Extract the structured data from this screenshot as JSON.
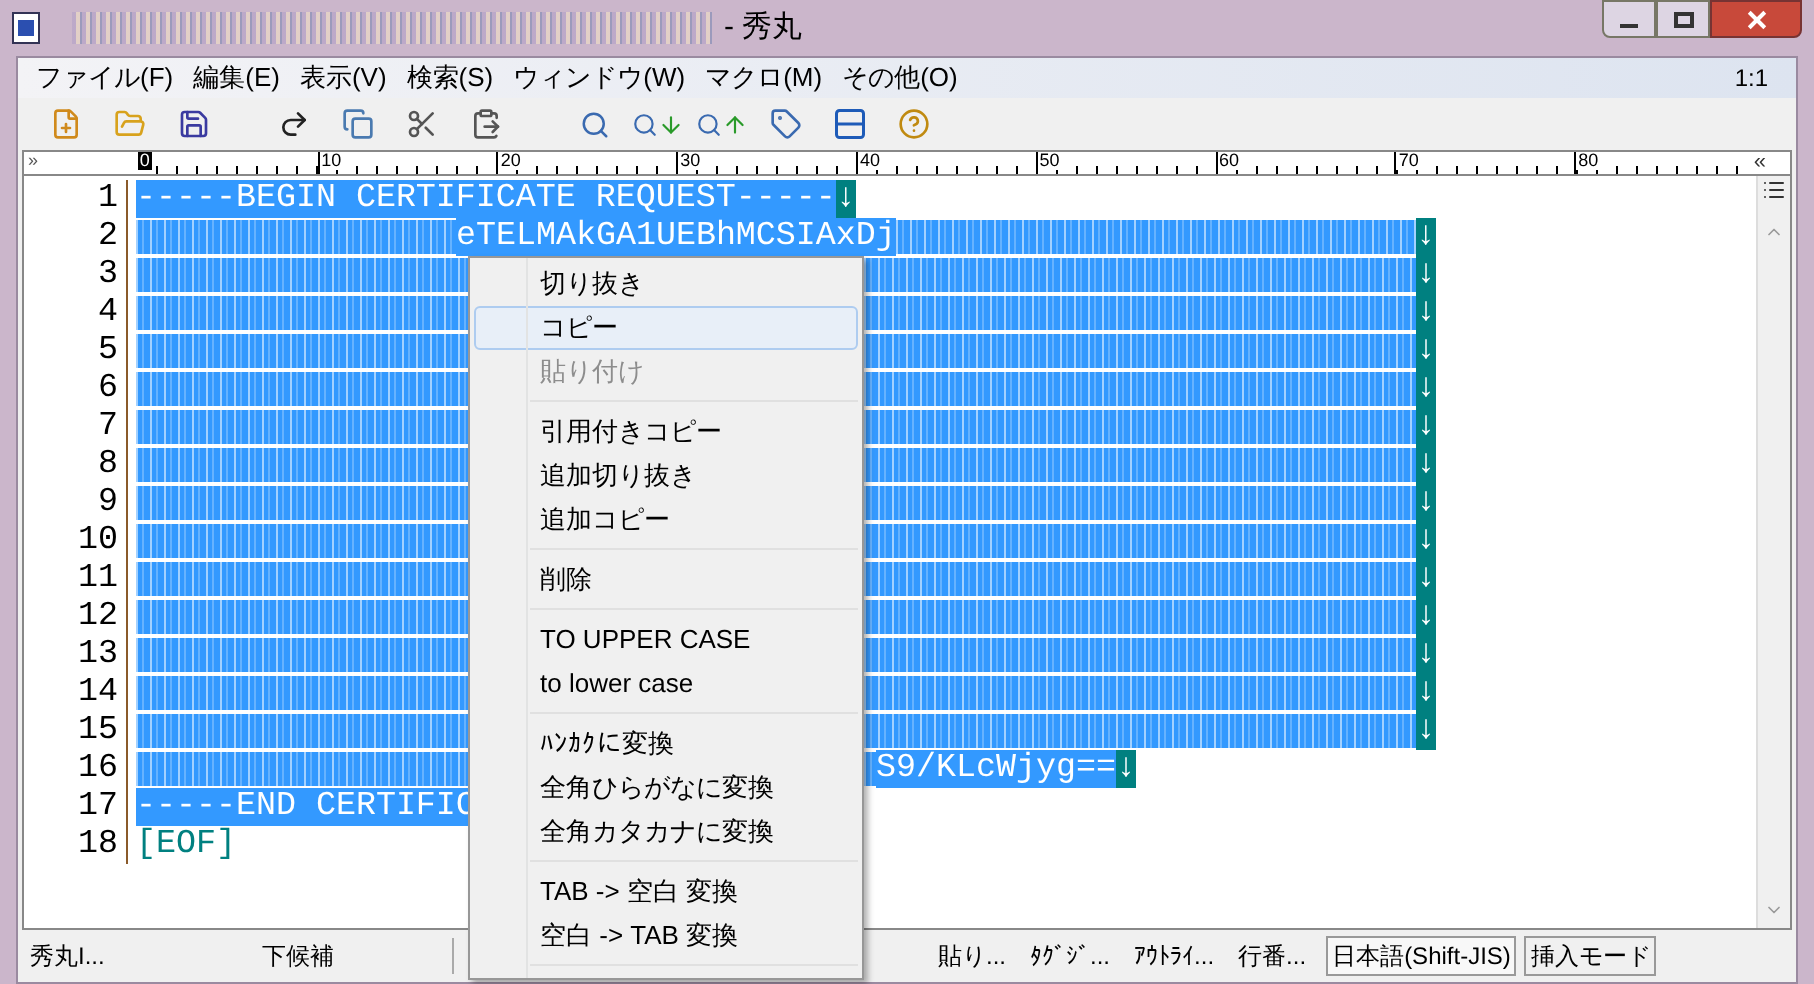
{
  "window": {
    "title": "- 秀丸"
  },
  "menu_bar": {
    "items": [
      {
        "label": "ファイル(F)"
      },
      {
        "label": "編集(E)"
      },
      {
        "label": "表示(V)"
      },
      {
        "label": "検索(S)"
      },
      {
        "label": "ウィンドウ(W)"
      },
      {
        "label": "マクロ(M)"
      },
      {
        "label": "その他(O)"
      }
    ],
    "position": "1:1"
  },
  "ruler": {
    "left_mark": "»",
    "right_mark": "«",
    "start": "0",
    "ticks": [
      "10",
      "20",
      "30",
      "40",
      "50",
      "60",
      "70",
      "80"
    ]
  },
  "editor": {
    "lines": [
      {
        "number": "1",
        "selected": true,
        "segments": [
          {
            "kind": "text",
            "text": "-----BEGIN CERTIFICATE REQUEST-----"
          }
        ],
        "eol": "↓"
      },
      {
        "number": "2",
        "selected": true,
        "segments": [
          {
            "kind": "redacted"
          },
          {
            "kind": "text",
            "text": "eTELMAkGA1UEBhMCSIAxDj"
          },
          {
            "kind": "redacted"
          }
        ],
        "eol": "↓"
      },
      {
        "number": "3",
        "selected": true,
        "segments": [
          {
            "kind": "redacted"
          }
        ],
        "eol": "↓"
      },
      {
        "number": "4",
        "selected": true,
        "segments": [
          {
            "kind": "redacted"
          }
        ],
        "eol": "↓"
      },
      {
        "number": "5",
        "selected": true,
        "segments": [
          {
            "kind": "redacted"
          }
        ],
        "eol": "↓"
      },
      {
        "number": "6",
        "selected": true,
        "segments": [
          {
            "kind": "redacted"
          }
        ],
        "eol": "↓"
      },
      {
        "number": "7",
        "selected": true,
        "segments": [
          {
            "kind": "redacted"
          }
        ],
        "eol": "↓"
      },
      {
        "number": "8",
        "selected": true,
        "segments": [
          {
            "kind": "redacted"
          }
        ],
        "eol": "↓"
      },
      {
        "number": "9",
        "selected": true,
        "segments": [
          {
            "kind": "redacted"
          }
        ],
        "eol": "↓"
      },
      {
        "number": "10",
        "selected": true,
        "segments": [
          {
            "kind": "redacted"
          }
        ],
        "eol": "↓"
      },
      {
        "number": "11",
        "selected": true,
        "segments": [
          {
            "kind": "redacted"
          }
        ],
        "eol": "↓"
      },
      {
        "number": "12",
        "selected": true,
        "segments": [
          {
            "kind": "redacted"
          }
        ],
        "eol": "↓"
      },
      {
        "number": "13",
        "selected": true,
        "segments": [
          {
            "kind": "redacted"
          }
        ],
        "eol": "↓"
      },
      {
        "number": "14",
        "selected": true,
        "segments": [
          {
            "kind": "redacted"
          }
        ],
        "eol": "↓"
      },
      {
        "number": "15",
        "selected": true,
        "segments": [
          {
            "kind": "redacted"
          }
        ],
        "eol": "↓"
      },
      {
        "number": "16",
        "selected": true,
        "segments": [
          {
            "kind": "redacted"
          },
          {
            "kind": "text",
            "text": "S9/KLcWjyg=="
          }
        ],
        "eol": "↓"
      },
      {
        "number": "17",
        "selected": true,
        "segments": [
          {
            "kind": "text",
            "text": "-----END CERTIFIC"
          }
        ]
      },
      {
        "number": "18",
        "selected": false,
        "segments": [
          {
            "kind": "eof",
            "text": "[EOF]"
          }
        ]
      }
    ]
  },
  "context_menu": {
    "items": [
      {
        "kind": "item",
        "label": "切り抜き",
        "selected": false,
        "disabled": false
      },
      {
        "kind": "item",
        "label": "コピー",
        "selected": true,
        "disabled": false
      },
      {
        "kind": "item",
        "label": "貼り付け",
        "selected": false,
        "disabled": true
      },
      {
        "kind": "separator"
      },
      {
        "kind": "item",
        "label": "引用付きコピー",
        "selected": false,
        "disabled": false
      },
      {
        "kind": "item",
        "label": "追加切り抜き",
        "selected": false,
        "disabled": false
      },
      {
        "kind": "item",
        "label": "追加コピー",
        "selected": false,
        "disabled": false
      },
      {
        "kind": "separator"
      },
      {
        "kind": "item",
        "label": "削除",
        "selected": false,
        "disabled": false
      },
      {
        "kind": "separator"
      },
      {
        "kind": "item",
        "label": "TO UPPER CASE",
        "selected": false,
        "disabled": false
      },
      {
        "kind": "item",
        "label": "to lower case",
        "selected": false,
        "disabled": false
      },
      {
        "kind": "separator"
      },
      {
        "kind": "item",
        "label": "ﾊﾝｶｸに変換",
        "selected": false,
        "disabled": false
      },
      {
        "kind": "item",
        "label": "全角ひらがなに変換",
        "selected": false,
        "disabled": false
      },
      {
        "kind": "item",
        "label": "全角カタカナに変換",
        "selected": false,
        "disabled": false
      },
      {
        "kind": "separator"
      },
      {
        "kind": "item",
        "label": "TAB -> 空白 変換",
        "selected": false,
        "disabled": false
      },
      {
        "kind": "item",
        "label": "空白 -> TAB 変換",
        "selected": false,
        "disabled": false
      },
      {
        "kind": "separator"
      }
    ]
  },
  "status_bar": {
    "left": [
      {
        "label": "秀丸I..."
      },
      {
        "label": "下候補"
      }
    ],
    "right": [
      {
        "label": "貼り..."
      },
      {
        "label": "ﾀｸﾞｼﾞ..."
      },
      {
        "label": "ｱｳﾄﾗｲ..."
      },
      {
        "label": "行番..."
      }
    ],
    "encoding": "日本語(Shift-JIS)",
    "mode": "挿入モード"
  }
}
